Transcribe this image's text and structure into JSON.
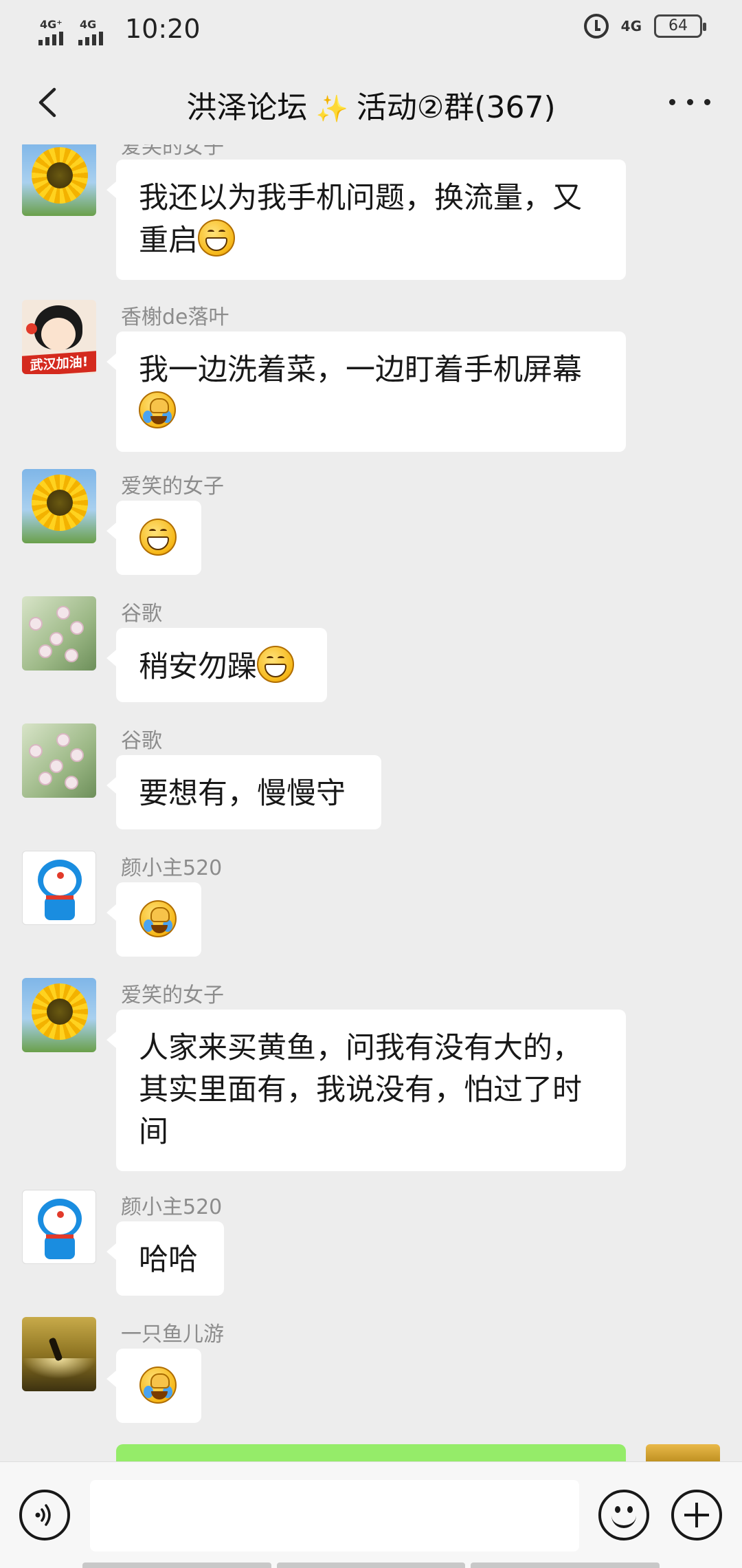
{
  "status_bar": {
    "sim1": "4G⁺",
    "sim2": "4G",
    "time": "10:20",
    "network": "4G",
    "battery": "64"
  },
  "header": {
    "title_part1": "洪泽论坛",
    "title_part2": "活动②群(367)",
    "back_icon": "chevron-left-icon",
    "more_icon": "more-dots-icon"
  },
  "messages": [
    {
      "sender": "爱笑的女子",
      "text": "我还以为我手机问题，换流量，又重启",
      "emoji": "grin",
      "avatar": "sunflower"
    },
    {
      "sender": "香榭de落叶",
      "text": "我一边洗着菜，一边盯着手机屏幕",
      "emoji": "facepalm",
      "avatar": "snow",
      "avatar_caption": "武汉加油!"
    },
    {
      "sender": "爱笑的女子",
      "text": "",
      "emoji": "grin",
      "avatar": "sunflower"
    },
    {
      "sender": "谷歌",
      "text": "稍安勿躁",
      "emoji": "grin",
      "avatar": "flower"
    },
    {
      "sender": "谷歌",
      "text": "要想有，慢慢守",
      "emoji": "",
      "avatar": "flower"
    },
    {
      "sender": "颜小主520",
      "text": "",
      "emoji": "facepalm",
      "avatar": "doraemon"
    },
    {
      "sender": "爱笑的女子",
      "text": "人家来买黄鱼，问我有没有大的，其实里面有，我说没有，怕过了时间",
      "emoji": "",
      "avatar": "sunflower"
    },
    {
      "sender": "颜小主520",
      "text": "哈哈",
      "emoji": "",
      "avatar": "doraemon"
    },
    {
      "sender": "一只鱼儿游",
      "text": "",
      "emoji": "facepalm",
      "avatar": "surf"
    }
  ],
  "input_bar": {
    "voice_icon": "voice-icon",
    "emoji_icon": "emoji-icon",
    "plus_icon": "plus-icon",
    "input_value": ""
  }
}
